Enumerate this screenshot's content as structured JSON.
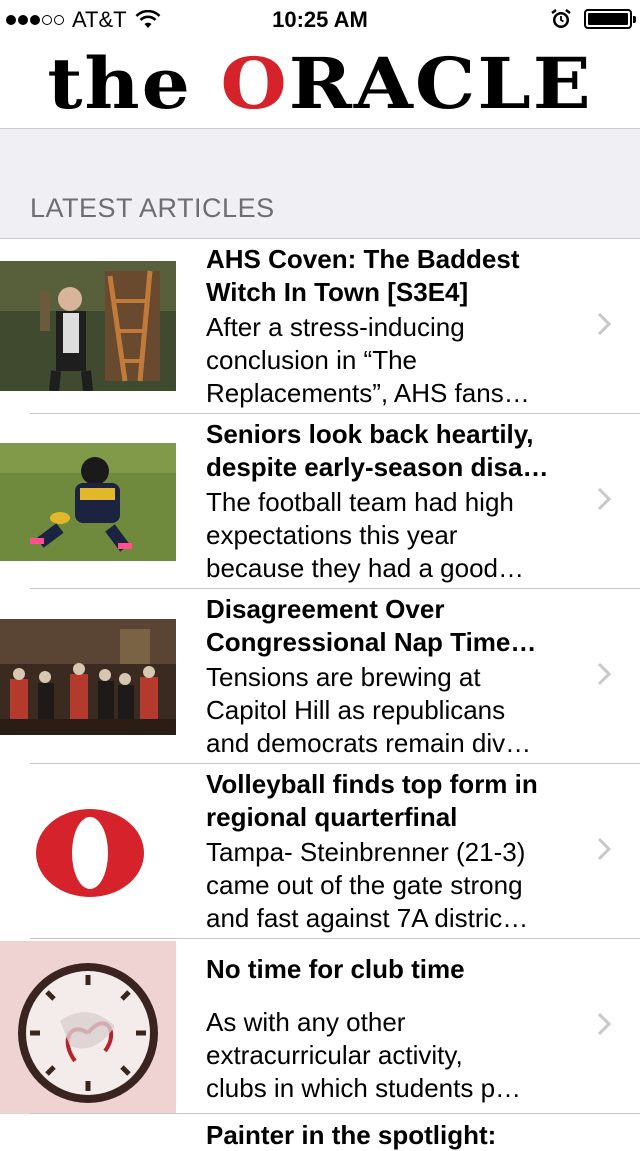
{
  "status_bar": {
    "carrier": "AT&T",
    "time": "10:25 AM",
    "signal_bars_filled": 3,
    "signal_bars_total": 5,
    "battery_level": 1.0
  },
  "masthead": {
    "logo_the": "the",
    "logo_o": "O",
    "logo_rest": "RACLE",
    "accent_color": "#d6222a"
  },
  "section": {
    "label": "LATEST ARTICLES"
  },
  "articles": [
    {
      "title_lines": [
        "AHS Coven: The Baddest",
        "Witch In Town [S3E4]"
      ],
      "desc_lines": [
        "After a stress-inducing",
        "conclusion in “The",
        "Replacements”, AHS fans…"
      ],
      "thumb": "photo-man-with-ladder"
    },
    {
      "title_lines": [
        "Seniors look back heartily,",
        "despite early-season disa…"
      ],
      "desc_lines": [
        "The football team had high",
        "expectations this year",
        "because they had a good…"
      ],
      "thumb": "photo-football-player"
    },
    {
      "title_lines": [
        "Disagreement Over",
        "Congressional Nap Time…"
      ],
      "desc_lines": [
        "Tensions are brewing at",
        "Capitol Hill as republicans",
        "and democrats remain div…"
      ],
      "thumb": "painting-congress"
    },
    {
      "title_lines": [
        "Volleyball finds top form in",
        "regional quarterfinal"
      ],
      "desc_lines": [
        "Tampa- Steinbrenner (21-3)",
        "came out of the gate strong",
        "and fast against 7A distric…"
      ],
      "thumb": "oracle-o-logo"
    },
    {
      "title_lines": [
        "No time for club time"
      ],
      "desc_lines": [
        "As with any other",
        "extracurricular activity,",
        "clubs in which students p…"
      ],
      "thumb": "clock-illustration"
    }
  ],
  "partial_article": {
    "title": "Painter in the spotlight:"
  }
}
